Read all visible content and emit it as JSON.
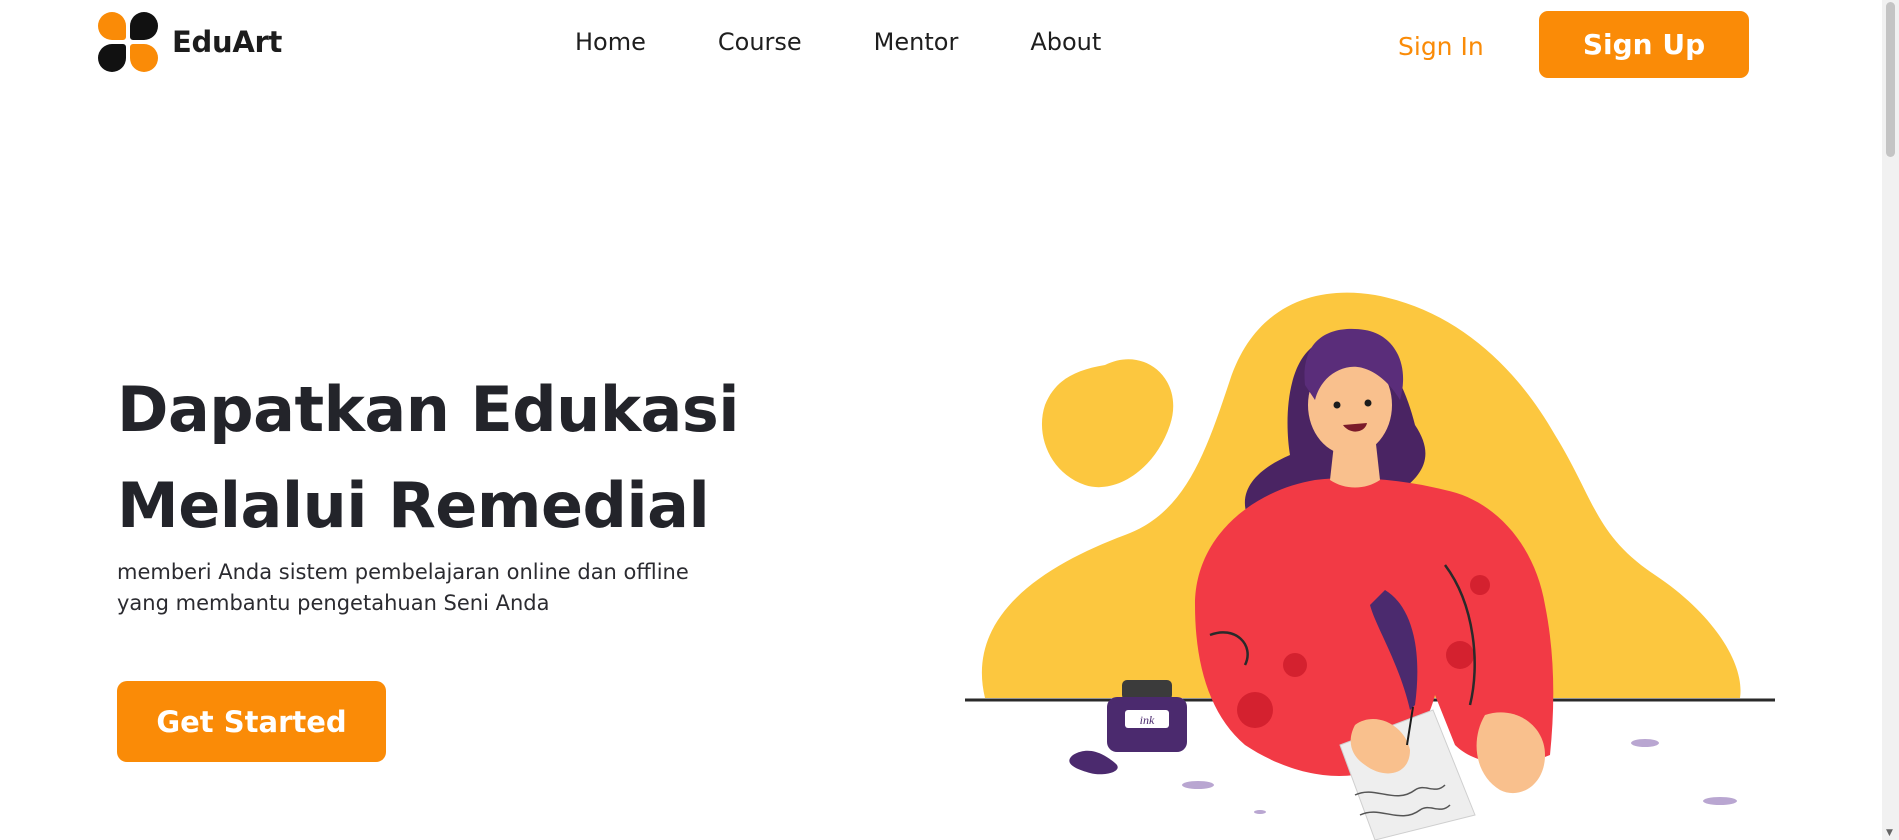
{
  "brand": {
    "name": "EduArt",
    "logo_icon": "four-petal-logo-icon",
    "accent": "#fa8b07",
    "dark": "#111111"
  },
  "nav": {
    "items": [
      {
        "label": "Home"
      },
      {
        "label": "Course"
      },
      {
        "label": "Mentor"
      },
      {
        "label": "About"
      }
    ]
  },
  "auth": {
    "signin_label": "Sign In",
    "signup_label": "Sign Up"
  },
  "hero": {
    "title_line1": "Dapatkan Edukasi",
    "title_line2": "Melalui Remedial",
    "subtitle_line1": "memberi Anda sistem pembelajaran online dan offline",
    "subtitle_line2": "yang membantu pengetahuan Seni Anda",
    "cta_label": "Get Started"
  },
  "illustration": {
    "description_icon": "woman-writing-with-quill-illustration",
    "ink_label": "ink",
    "colors": {
      "blob": "#fcc73f",
      "shirt": "#f23a45",
      "hair": "#5a2d7a",
      "skin": "#f9c08d",
      "ink": "#4b2a6e"
    }
  }
}
